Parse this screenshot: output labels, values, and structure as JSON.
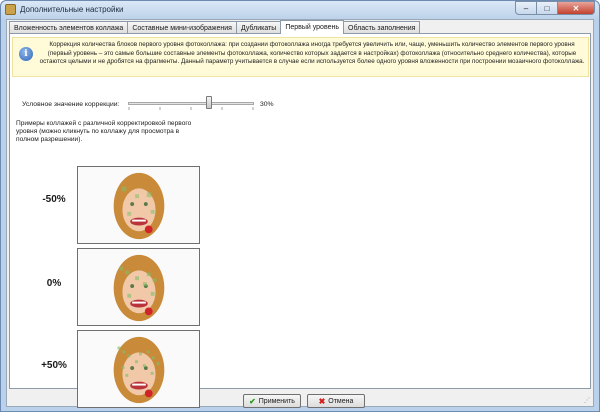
{
  "window": {
    "title": "Дополнительные настройки",
    "buttons": {
      "minimize": "–",
      "maximize": "□",
      "close": "✕"
    }
  },
  "tabs": [
    {
      "label": "Вложенность элементов коллажа",
      "active": false
    },
    {
      "label": "Составные мини-изображения",
      "active": false
    },
    {
      "label": "Дубликаты",
      "active": false
    },
    {
      "label": "Первый уровень",
      "active": true
    },
    {
      "label": "Область заполнения",
      "active": false
    }
  ],
  "info": {
    "icon": "info-icon",
    "text": "Коррекция количества блоков первого уровня фотоколлажа: при создании фотоколлажа иногда требуется увеличить или, чаще, уменьшить количество элементов первого уровня (первый уровень – это самые большие составные элементы фотоколлажа, количество которых задается в настройках) фотоколлажа (относительно среднего количества), которые остаются целыми и не дробятся на фрагменты. Данный параметр учитывается в случае если используется более одного уровня вложенности при построении мозаичного фотоколлажа."
  },
  "correction": {
    "label": "Условное значение коррекции:",
    "value_text": "30%",
    "value": 30,
    "min": -100,
    "max": 100
  },
  "examples": {
    "title": "Примеры коллажей с различной корректировкой первого уровня (можно кликнуть по коллажу для просмотра в полном разрешении).",
    "items": [
      {
        "label": "-50%"
      },
      {
        "label": "0%"
      },
      {
        "label": "+50%"
      }
    ]
  },
  "footer": {
    "apply_label": "Применить",
    "cancel_label": "Отмена"
  },
  "colors": {
    "accent": "#fffbd9",
    "ok_icon": "#2f9a22",
    "cancel_icon": "#d22020"
  }
}
